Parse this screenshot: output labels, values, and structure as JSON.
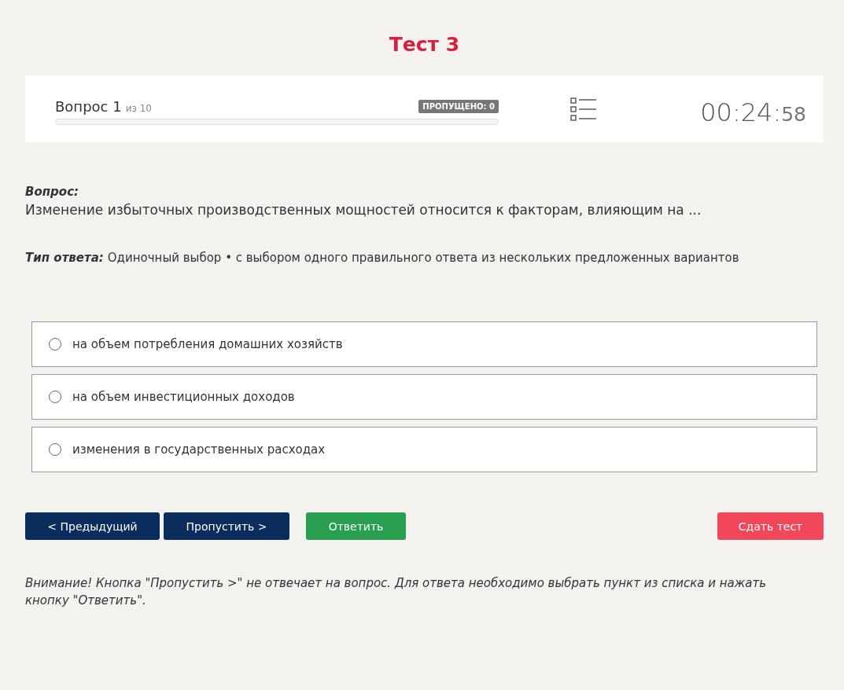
{
  "title": "Тест 3",
  "header": {
    "question_label": "Вопрос 1",
    "question_total": "из 10",
    "progress": {
      "level": 0
    },
    "skipped_badge": "ПРОПУЩЕНО: 0",
    "timer_main": "00:24:",
    "timer_seconds": "58"
  },
  "question": {
    "label": "Вопрос:",
    "text": "Изменение избыточных производственных мощностей относится к факторам, влияющим на ...",
    "answer_type_label": "Тип ответа:",
    "answer_type": "Одиночный выбор • с выбором одного правильного ответа из нескольких предложенных вариантов"
  },
  "options": [
    {
      "text": "на объем потребления домашних хозяйств",
      "selected": false
    },
    {
      "text": "на объем инвестиционных доходов",
      "selected": false
    },
    {
      "text": "изменения в государственных расходах",
      "selected": false
    }
  ],
  "buttons": [
    {
      "label": "< Предыдущий",
      "kind": "primary"
    },
    {
      "label": "Пропустить >",
      "kind": "primary"
    },
    {
      "label": "Ответить",
      "kind": "success"
    },
    {
      "label": "Сдать тест",
      "kind": "danger"
    }
  ],
  "notice": "Внимание! Кнопка \"Пропустить >\" не отвечает на вопрос. Для ответа необходимо выбрать пункт из списка и нажать кнопку \"Ответить\"."
}
